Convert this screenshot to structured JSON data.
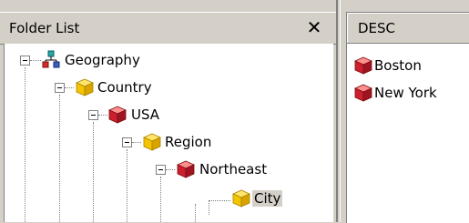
{
  "left_panel": {
    "title": "Folder List",
    "close_label": "✕",
    "tree": [
      {
        "label": "Geography",
        "icon": "hierarchy-icon"
      },
      {
        "label": "Country",
        "icon": "gold-cube-icon"
      },
      {
        "label": "USA",
        "icon": "red-cube-icon"
      },
      {
        "label": "Region",
        "icon": "gold-cube-icon"
      },
      {
        "label": "Northeast",
        "icon": "red-cube-icon"
      },
      {
        "label": "City",
        "icon": "gold-cube-icon",
        "selected": true
      }
    ]
  },
  "right_panel": {
    "column_header": "DESC",
    "items": [
      {
        "label": "Boston",
        "icon": "red-cube-icon"
      },
      {
        "label": "New York",
        "icon": "red-cube-icon"
      }
    ]
  },
  "colors": {
    "window_bg": "#d4d0c8",
    "gold_cube": "#f4c400",
    "red_cube": "#cc1f2f",
    "selected_bg": "#d4d0c8"
  }
}
